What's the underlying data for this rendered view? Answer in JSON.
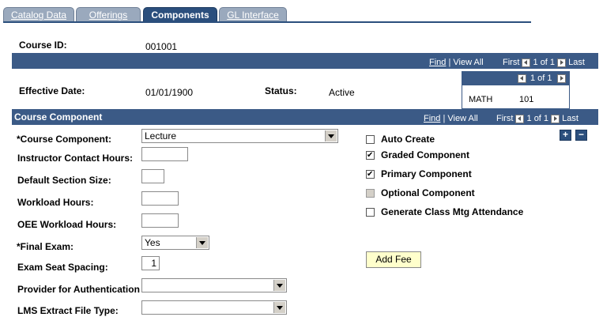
{
  "tabs": [
    {
      "label": "Catalog Data"
    },
    {
      "label": "Offerings"
    },
    {
      "label": "Components"
    },
    {
      "label": "GL Interface"
    }
  ],
  "course": {
    "id_label": "Course ID:",
    "id_value": "001001"
  },
  "top_nav": {
    "find": "Find",
    "view_all": "View All",
    "first": "First",
    "count": "1 of 1",
    "last": "Last"
  },
  "effective": {
    "date_label": "Effective Date:",
    "date_value": "01/01/1900",
    "status_label": "Status:",
    "status_value": "Active"
  },
  "offering_grid": {
    "count": "1 of 1",
    "subject": "MATH",
    "catalog_nbr": "101"
  },
  "component_section": {
    "title": "Course Component",
    "nav": {
      "find": "Find",
      "view_all": "View All",
      "first": "First",
      "count": "1 of 1",
      "last": "Last"
    },
    "add_symbol": "+",
    "remove_symbol": "−"
  },
  "form": {
    "course_component_label": "*Course Component:",
    "course_component_value": "Lecture",
    "instructor_contact_label": "Instructor Contact Hours:",
    "instructor_contact_value": "",
    "default_section_label": "Default Section Size:",
    "default_section_value": "",
    "workload_label": "Workload Hours:",
    "workload_value": "",
    "oee_workload_label": "OEE Workload Hours:",
    "oee_workload_value": "",
    "final_exam_label": "*Final Exam:",
    "final_exam_value": "Yes",
    "exam_seat_label": "Exam Seat Spacing:",
    "exam_seat_value": "1",
    "provider_label": "Provider for Authentication",
    "provider_value": "",
    "lms_label": "LMS Extract File Type:",
    "lms_value": ""
  },
  "checkboxes": [
    {
      "label": "Auto Create",
      "checked": false
    },
    {
      "label": "Graded Component",
      "checked": true
    },
    {
      "label": "Primary Component",
      "checked": true
    },
    {
      "label": "Optional Component",
      "checked": false
    },
    {
      "label": "Generate Class Mtg Attendance",
      "checked": false
    }
  ],
  "add_fee_label": "Add Fee"
}
